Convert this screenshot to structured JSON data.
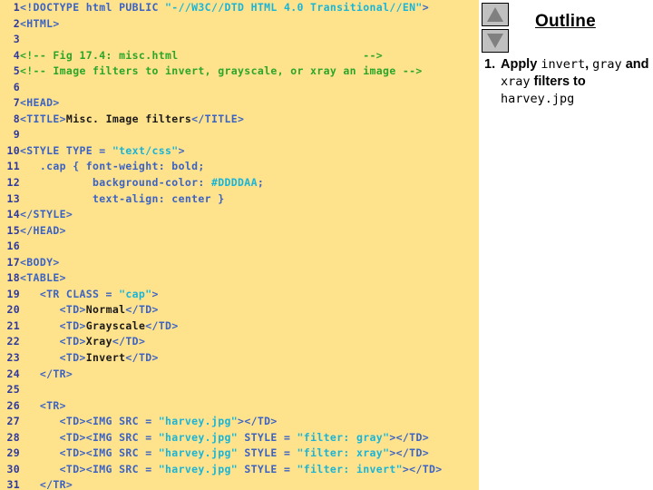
{
  "code_pane": {
    "background_color": "#FFE28C",
    "lines": [
      {
        "n": "1",
        "segments": [
          {
            "t": "<!DOCTYPE html PUBLIC ",
            "c": "tag"
          },
          {
            "t": "\"-//W3C//DTD HTML 4.0 Transitional//EN\"",
            "c": "str"
          },
          {
            "t": ">",
            "c": "tag"
          }
        ]
      },
      {
        "n": "2",
        "segments": [
          {
            "t": "<HTML>",
            "c": "tag"
          }
        ]
      },
      {
        "n": "3",
        "segments": []
      },
      {
        "n": "4",
        "segments": [
          {
            "t": "<!-- Fig 17.4: misc.html                            -->",
            "c": "comment"
          }
        ]
      },
      {
        "n": "5",
        "segments": [
          {
            "t": "<!-- Image filters to invert, grayscale, or xray an image -->",
            "c": "comment"
          }
        ]
      },
      {
        "n": "6",
        "segments": []
      },
      {
        "n": "7",
        "segments": [
          {
            "t": "<HEAD>",
            "c": "tag"
          }
        ]
      },
      {
        "n": "8",
        "segments": [
          {
            "t": "<TITLE>",
            "c": "tag"
          },
          {
            "t": "Misc. Image filters",
            "c": "text"
          },
          {
            "t": "</TITLE>",
            "c": "tag"
          }
        ]
      },
      {
        "n": "9",
        "segments": []
      },
      {
        "n": "10",
        "segments": [
          {
            "t": "<STYLE TYPE = ",
            "c": "tag"
          },
          {
            "t": "\"text/css\"",
            "c": "str"
          },
          {
            "t": ">",
            "c": "tag"
          }
        ]
      },
      {
        "n": "11",
        "segments": [
          {
            "t": "   .cap { font-weight: bold;",
            "c": "plain"
          }
        ]
      },
      {
        "n": "12",
        "segments": [
          {
            "t": "           background-color: ",
            "c": "plain"
          },
          {
            "t": "#DDDDAA",
            "c": "str"
          },
          {
            "t": ";",
            "c": "plain"
          }
        ]
      },
      {
        "n": "13",
        "segments": [
          {
            "t": "           text-align: center }",
            "c": "plain"
          }
        ]
      },
      {
        "n": "14",
        "segments": [
          {
            "t": "</STYLE>",
            "c": "tag"
          }
        ]
      },
      {
        "n": "15",
        "segments": [
          {
            "t": "</HEAD>",
            "c": "tag"
          }
        ]
      },
      {
        "n": "16",
        "segments": []
      },
      {
        "n": "17",
        "segments": [
          {
            "t": "<BODY>",
            "c": "tag"
          }
        ]
      },
      {
        "n": "18",
        "segments": [
          {
            "t": "<TABLE>",
            "c": "tag"
          }
        ]
      },
      {
        "n": "19",
        "segments": [
          {
            "t": "   <TR CLASS = ",
            "c": "tag"
          },
          {
            "t": "\"cap\"",
            "c": "str"
          },
          {
            "t": ">",
            "c": "tag"
          }
        ]
      },
      {
        "n": "20",
        "segments": [
          {
            "t": "      <TD>",
            "c": "tag"
          },
          {
            "t": "Normal",
            "c": "text"
          },
          {
            "t": "</TD>",
            "c": "tag"
          }
        ]
      },
      {
        "n": "21",
        "segments": [
          {
            "t": "      <TD>",
            "c": "tag"
          },
          {
            "t": "Grayscale",
            "c": "text"
          },
          {
            "t": "</TD>",
            "c": "tag"
          }
        ]
      },
      {
        "n": "22",
        "segments": [
          {
            "t": "      <TD>",
            "c": "tag"
          },
          {
            "t": "Xray",
            "c": "text"
          },
          {
            "t": "</TD>",
            "c": "tag"
          }
        ]
      },
      {
        "n": "23",
        "segments": [
          {
            "t": "      <TD>",
            "c": "tag"
          },
          {
            "t": "Invert",
            "c": "text"
          },
          {
            "t": "</TD>",
            "c": "tag"
          }
        ]
      },
      {
        "n": "24",
        "segments": [
          {
            "t": "   </TR>",
            "c": "tag"
          }
        ]
      },
      {
        "n": "25",
        "segments": []
      },
      {
        "n": "26",
        "segments": [
          {
            "t": "   <TR>",
            "c": "tag"
          }
        ]
      },
      {
        "n": "27",
        "segments": [
          {
            "t": "      <TD><IMG SRC = ",
            "c": "tag"
          },
          {
            "t": "\"harvey.jpg\"",
            "c": "str"
          },
          {
            "t": "></TD>",
            "c": "tag"
          }
        ]
      },
      {
        "n": "28",
        "segments": [
          {
            "t": "      <TD><IMG SRC = ",
            "c": "tag"
          },
          {
            "t": "\"harvey.jpg\"",
            "c": "str"
          },
          {
            "t": " STYLE = ",
            "c": "tag"
          },
          {
            "t": "\"filter: gray\"",
            "c": "str"
          },
          {
            "t": "></TD>",
            "c": "tag"
          }
        ]
      },
      {
        "n": "29",
        "segments": [
          {
            "t": "      <TD><IMG SRC = ",
            "c": "tag"
          },
          {
            "t": "\"harvey.jpg\"",
            "c": "str"
          },
          {
            "t": " STYLE = ",
            "c": "tag"
          },
          {
            "t": "\"filter: xray\"",
            "c": "str"
          },
          {
            "t": "></TD>",
            "c": "tag"
          }
        ]
      },
      {
        "n": "30",
        "segments": [
          {
            "t": "      <TD><IMG SRC = ",
            "c": "tag"
          },
          {
            "t": "\"harvey.jpg\"",
            "c": "str"
          },
          {
            "t": " STYLE = ",
            "c": "tag"
          },
          {
            "t": "\"filter: invert\"",
            "c": "str"
          },
          {
            "t": "></TD>",
            "c": "tag"
          }
        ]
      },
      {
        "n": "31",
        "segments": [
          {
            "t": "   </TR>",
            "c": "tag"
          }
        ]
      }
    ],
    "colors": {
      "line_number": "#2F3A9E",
      "tag": "#3B63C4",
      "string": "#18B5D8",
      "comment": "#2AA62A",
      "content_text": "#1A1A1A"
    }
  },
  "outline_pane": {
    "title": "Outline",
    "nav": {
      "up_icon": "triangle-up-icon",
      "down_icon": "triangle-down-icon"
    },
    "items": [
      {
        "number": "1.",
        "parts": [
          {
            "text": "Apply ",
            "mono": false
          },
          {
            "text": "invert",
            "mono": true
          },
          {
            "text": ", ",
            "mono": false
          },
          {
            "text": "gray",
            "mono": true
          },
          {
            "text": " and ",
            "mono": false
          },
          {
            "text": "xray",
            "mono": true
          },
          {
            "text": " filters to ",
            "mono": false
          },
          {
            "text": "harvey.jpg",
            "mono": true
          }
        ]
      }
    ]
  }
}
